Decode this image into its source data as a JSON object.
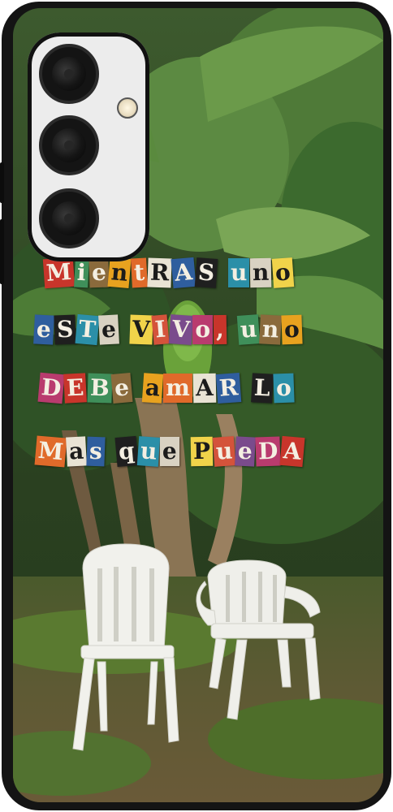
{
  "phrase": {
    "lines": [
      [
        {
          "word": "Mientras",
          "tiles": [
            "M",
            "i",
            "e",
            "n",
            "t",
            "R",
            "A",
            "S"
          ]
        },
        {
          "word": "uno",
          "tiles": [
            "u",
            "n",
            "o"
          ]
        }
      ],
      [
        {
          "word": "este",
          "tiles": [
            "e",
            "S",
            "T",
            "e"
          ]
        },
        {
          "word": "vivo,",
          "tiles": [
            "V",
            "I",
            "V",
            "o",
            ","
          ]
        },
        {
          "word": "uno",
          "tiles": [
            "u",
            "n",
            "o"
          ]
        }
      ],
      [
        {
          "word": "Debe",
          "tiles": [
            "D",
            "E",
            "B",
            "e"
          ]
        },
        {
          "word": "amar",
          "tiles": [
            "a",
            "m",
            "A",
            "R"
          ]
        },
        {
          "word": "lo",
          "tiles": [
            "L",
            "o"
          ]
        }
      ],
      [
        {
          "word": "Mas",
          "tiles": [
            "M",
            "a",
            "s"
          ]
        },
        {
          "word": "que",
          "tiles": [
            "q",
            "u",
            "e"
          ]
        },
        {
          "word": "Pueda",
          "tiles": [
            "P",
            "u",
            "e",
            "D",
            "A"
          ]
        }
      ]
    ]
  },
  "colors": {
    "case": "#141414",
    "camera_module": "#ececec",
    "tile_palette": [
      "#c8352b",
      "#e8a21f",
      "#2f5e9e",
      "#d9d2c2",
      "#7a4b8c",
      "#3f8f5a",
      "#e06a2a",
      "#1f1f1f",
      "#f1d34a",
      "#b93b6e",
      "#8a6a3c",
      "#e9e3d4",
      "#2b8fa8",
      "#d4533b"
    ]
  }
}
